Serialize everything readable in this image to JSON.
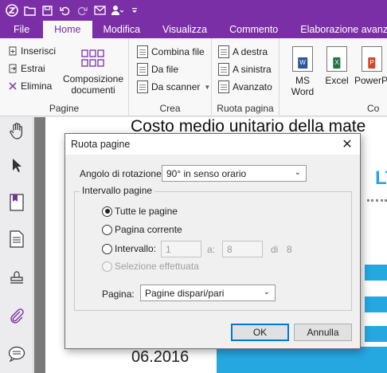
{
  "titlebar": {
    "icons": [
      "app-logo-icon",
      "open-folder-icon",
      "save-icon",
      "undo-icon",
      "redo-icon",
      "mail-icon",
      "user-icon",
      "customize-icon"
    ]
  },
  "tabs": [
    "File",
    "Home",
    "Modifica",
    "Visualizza",
    "Commento",
    "Elaborazione avanzata"
  ],
  "ribbon": {
    "pagine": {
      "inserisci": "Inserisci",
      "estrai": "Estrai",
      "elimina": "Elimina",
      "composizione_line1": "Composizione",
      "composizione_line2": "documenti",
      "label": "Pagine"
    },
    "crea": {
      "combina": "Combina file",
      "dafile": "Da file",
      "dascanner": "Da scanner",
      "label": "Crea"
    },
    "ruota": {
      "destra": "A destra",
      "sinistra": "A sinistra",
      "avanzato": "Avanzato",
      "label": "Ruota pagina"
    },
    "converti": {
      "msword_line1": "MS",
      "msword_line2": "Word",
      "excel": "Excel",
      "powerpoint": "PowerP",
      "label": "Co",
      "badge_w": "W",
      "badge_x": "X",
      "badge_p": "P"
    }
  },
  "document": {
    "title": "Costo medio unitario della mate",
    "side_text": "LT",
    "date": "06.2016"
  },
  "dialog": {
    "title": "Ruota pagine",
    "angle_label": "Angolo di rotazione:",
    "angle_value": "90° in senso orario",
    "range_group": "Intervallo pagine",
    "opt_all": "Tutte le pagine",
    "opt_current": "Pagina corrente",
    "opt_interval": "Intervallo:",
    "interval_from": "1",
    "interval_to_label": "a:",
    "interval_to": "8",
    "of_label": "di",
    "of_value": "8",
    "opt_selection": "Selezione effettuata",
    "page_label": "Pagina:",
    "page_value": "Pagine dispari/pari",
    "ok": "OK",
    "cancel": "Annulla"
  },
  "colors": {
    "brand": "#7b2fa6",
    "accent_blue": "#25a7e0",
    "word_blue": "#2b579a",
    "excel_green": "#217346",
    "ppt_red": "#d24726"
  }
}
